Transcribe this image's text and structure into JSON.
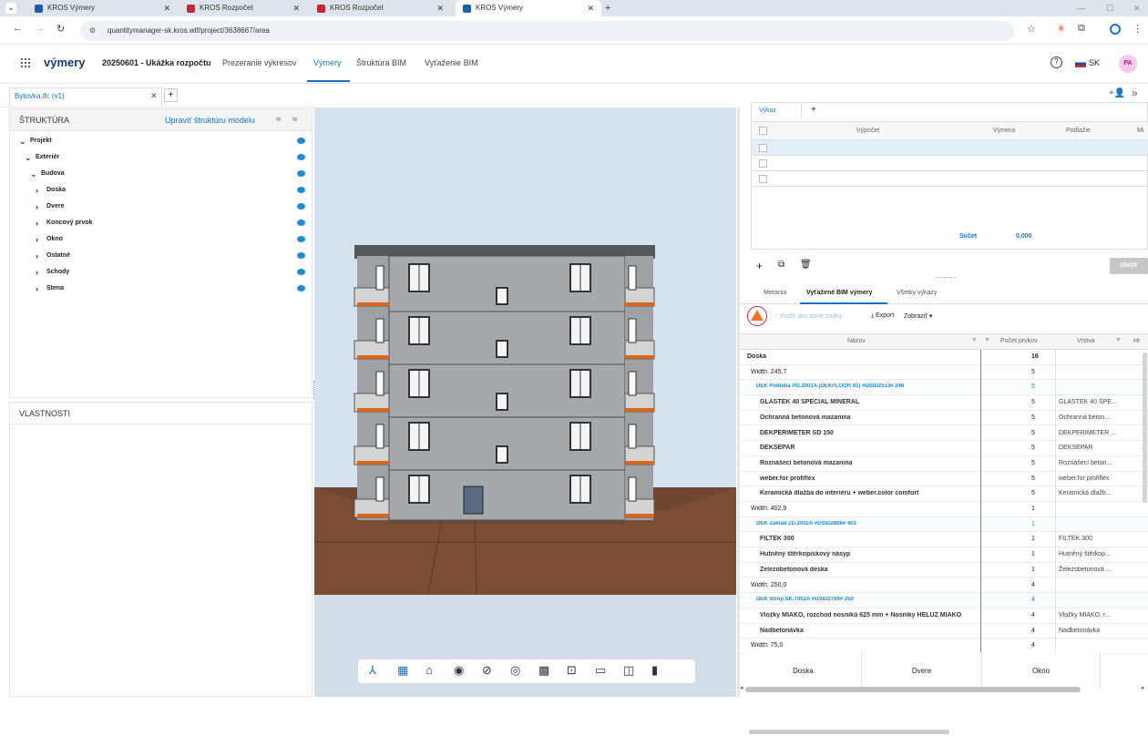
{
  "browser": {
    "tabs": [
      {
        "label": "KROS Výmery",
        "fav": "#1b5ea8"
      },
      {
        "label": "KROS Rozpočet",
        "fav": "#c0283a"
      },
      {
        "label": "KROS Rozpočet",
        "fav": "#c0283a"
      },
      {
        "label": "KROS Výmery",
        "fav": "#1b5ea8"
      }
    ],
    "url": "quantitymanager-sk.kros.wtf/project/3638667/area"
  },
  "app": {
    "brand": "výmery",
    "nav": [
      "20250601 - Ukážka rozpočtu",
      "Prezeranie výkresov",
      "Výmery",
      "Štruktúra BIM",
      "Vyťaženie BIM"
    ],
    "lang": "SK",
    "avatar": "PA"
  },
  "file_tab": {
    "label": "Bytovka.ifc (v1)"
  },
  "structure": {
    "title": "ŠTRUKTÚRA",
    "edit_link": "Upraviť štruktúru modelu",
    "tree": [
      {
        "label": "Projekt",
        "toggle": "⌄",
        "level": 0
      },
      {
        "label": "Exteriér",
        "toggle": "⌄",
        "level": 1
      },
      {
        "label": "Budova",
        "toggle": "⌄",
        "level": 2
      },
      {
        "label": "Doska",
        "toggle": "›",
        "level": 3
      },
      {
        "label": "Dvere",
        "toggle": "›",
        "level": 3
      },
      {
        "label": "Koncový prvok",
        "toggle": "›",
        "level": 3
      },
      {
        "label": "Okno",
        "toggle": "›",
        "level": 3
      },
      {
        "label": "Ostatné",
        "toggle": "›",
        "level": 3
      },
      {
        "label": "Schody",
        "toggle": "›",
        "level": 3
      },
      {
        "label": "Stena",
        "toggle": "›",
        "level": 3
      }
    ]
  },
  "properties": {
    "title": "VLASTNOSTI"
  },
  "viewer_toolbar": [
    "axes-icon",
    "table-icon",
    "home-icon",
    "eye-icon",
    "eye-off-icon",
    "target-icon",
    "section-icon",
    "zoom-box-icon",
    "measure-icon",
    "split-icon",
    "book-icon"
  ],
  "report": {
    "tab": "Výkaz",
    "columns": [
      "Výpočet",
      "Výmera",
      "Podlažie",
      "Mi"
    ],
    "sum_label": "Súčet",
    "sum_value": "0,000",
    "save_label": "Uložiť"
  },
  "lower_tabs": [
    "Merania",
    "Vyťažené BIM výmery",
    "Všetky výkazy"
  ],
  "toolbar2": {
    "insert": "Vložiť ako nové riadky",
    "export": "Export",
    "show": "Zobraziť"
  },
  "grid": {
    "columns": [
      "Názov",
      "Počet prvkov",
      "Vrstva",
      "Hr"
    ],
    "rows": [
      {
        "name": "Doska",
        "count": "16",
        "layer": "",
        "kind": "group"
      },
      {
        "name": "Width: 245,7",
        "count": "5",
        "layer": "",
        "kind": "width"
      },
      {
        "name": "DEK Podlaha PD.2001A (DEKFLOOR 01) #DSID2513# 246",
        "count": "5",
        "layer": "",
        "kind": "type"
      },
      {
        "name": "GLASTEK 40 SPECIAL MINERAL",
        "count": "5",
        "layer": "GLASTEK 40 SPE...",
        "kind": "item"
      },
      {
        "name": "Ochranná betonová mazanina",
        "count": "5",
        "layer": "Ochranná beton...",
        "kind": "item"
      },
      {
        "name": "DEKPERIMETER SD 150",
        "count": "5",
        "layer": "DEKPERIMETER ...",
        "kind": "item"
      },
      {
        "name": "DEKSEPAR",
        "count": "5",
        "layer": "DEKSEPAR",
        "kind": "item"
      },
      {
        "name": "Roznášecí betonová mazanina",
        "count": "5",
        "layer": "Roznášecí beton...",
        "kind": "item"
      },
      {
        "name": "weber.for profiflex",
        "count": "5",
        "layer": "weber.for profiflex",
        "kind": "item"
      },
      {
        "name": "Keramická dlažba do interiéru + weber.color comfort",
        "count": "5",
        "layer": "Keramická dlažb...",
        "kind": "item"
      },
      {
        "name": "Width: 402,9",
        "count": "1",
        "layer": "",
        "kind": "width"
      },
      {
        "name": "DEK Základ ZD.2002A #DSID2868# 403",
        "count": "1",
        "layer": "",
        "kind": "type"
      },
      {
        "name": "FILTEK 300",
        "count": "1",
        "layer": "FILTEK 300",
        "kind": "item"
      },
      {
        "name": "Hutněný štěrkopískový násyp",
        "count": "1",
        "layer": "Hutněný štěrkop...",
        "kind": "item"
      },
      {
        "name": "Železobetonová deska",
        "count": "1",
        "layer": "Železobetonová ...",
        "kind": "item"
      },
      {
        "name": "Width: 250,0",
        "count": "4",
        "layer": "",
        "kind": "width"
      },
      {
        "name": "DEK Strop SK.7002A #DSID2769# 250",
        "count": "4",
        "layer": "",
        "kind": "type"
      },
      {
        "name": "Vložky MIAKO, rozchod nosníků 625 mm + Nosníky HELUZ MIAKO",
        "count": "4",
        "layer": "Vložky MIAKO, r...",
        "kind": "item"
      },
      {
        "name": "Nadbetonávka",
        "count": "4",
        "layer": "Nadbetonávka",
        "kind": "item"
      },
      {
        "name": "Width: 75,0",
        "count": "4",
        "layer": "",
        "kind": "width"
      }
    ]
  },
  "bottom_tabs": [
    "Doska",
    "Dvere",
    "Okno"
  ],
  "colors": {
    "accent": "#1a73c7",
    "type_row": "#1a8ad4",
    "warning": "#e7772a",
    "ground": "#6e4632"
  }
}
